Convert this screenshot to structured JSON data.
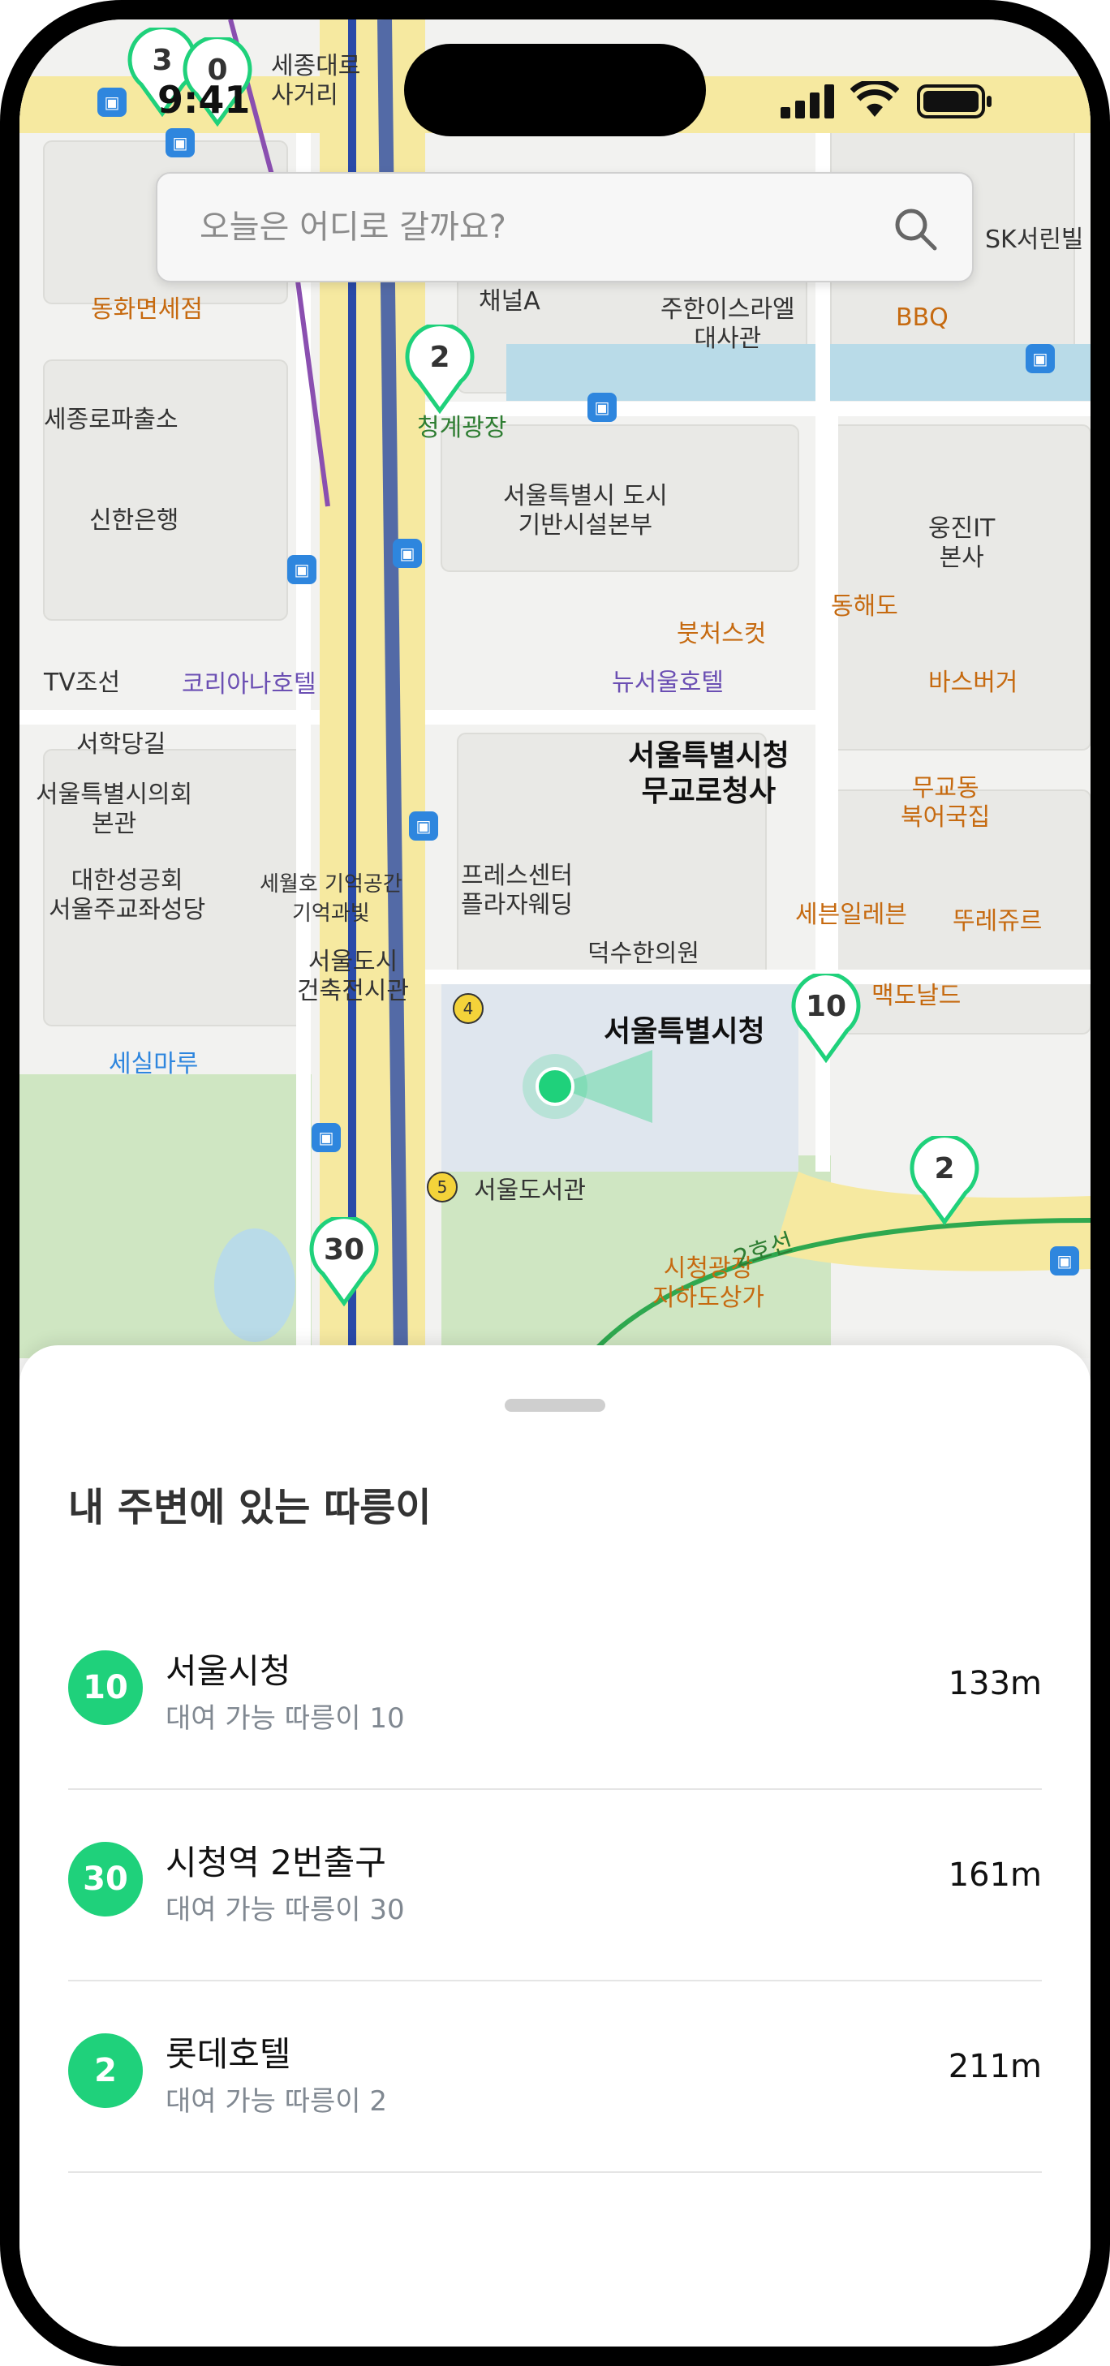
{
  "status_bar": {
    "time": "9:41"
  },
  "search": {
    "placeholder": "오늘은 어디로 갈까요?"
  },
  "map": {
    "labels": {
      "sejongdaero_sageori": "세종대로\n사거리",
      "dongwha": "동화면세점",
      "channel_a": "채널A",
      "cheonggye": "청계광장",
      "korea_is": "주한이스라엘\n대사관",
      "bbq": "BBQ",
      "sk": "SK서린빌",
      "sejongro_police": "세종로파출소",
      "seoul_infra": "서울특별시 도시\n기반시설본부",
      "shinhan": "신한은행",
      "woongjin": "웅진IT\n본사",
      "donghae": "동해도",
      "butcher": "붓처스컷",
      "tvchosun": "TV조선",
      "korea_hotel": "코리아나호텔",
      "new_seoul_hotel": "뉴서울호텔",
      "burger": "바스버거",
      "seohak": "서학당길",
      "council": "서울특별시의회\n본관",
      "mugyo_office": "서울특별시청\n무교로청사",
      "mugyo_soup": "무교동\n북어국집",
      "anglican": "대한성공회\n서울주교좌성당",
      "sewol": "세월호 기억공간\n기억과빛",
      "press": "프레스센터\n플라자웨딩",
      "seven": "세븐일레븐",
      "ddure": "뚜레쥬르",
      "duksu": "덕수한의원",
      "arch": "서울도시\n건축전시관",
      "cityhall": "서울특별시청",
      "mcd": "맥도날드",
      "semaru": "세실마루",
      "library": "서울도서관",
      "plaza_mall": "시청광장\n지하도상가",
      "line2": "2호선"
    },
    "markers": [
      {
        "count": "3"
      },
      {
        "count": "0"
      },
      {
        "count": "2"
      },
      {
        "count": "10"
      },
      {
        "count": "2"
      },
      {
        "count": "30"
      }
    ]
  },
  "sheet": {
    "title": "내 주변에 있는 따릉이",
    "stations": [
      {
        "badge": "10",
        "name": "서울시청",
        "sub": "대여 가능 따릉이 10",
        "distance": "133m"
      },
      {
        "badge": "30",
        "name": "시청역 2번출구",
        "sub": "대여 가능 따릉이 30",
        "distance": "161m"
      },
      {
        "badge": "2",
        "name": "롯데호텔",
        "sub": "대여 가능 따릉이 2",
        "distance": "211m"
      }
    ]
  },
  "colors": {
    "accent": "#1fd17b",
    "road": "#f6e9a0",
    "park": "#cfe6c2",
    "water": "#b9dbe8"
  }
}
